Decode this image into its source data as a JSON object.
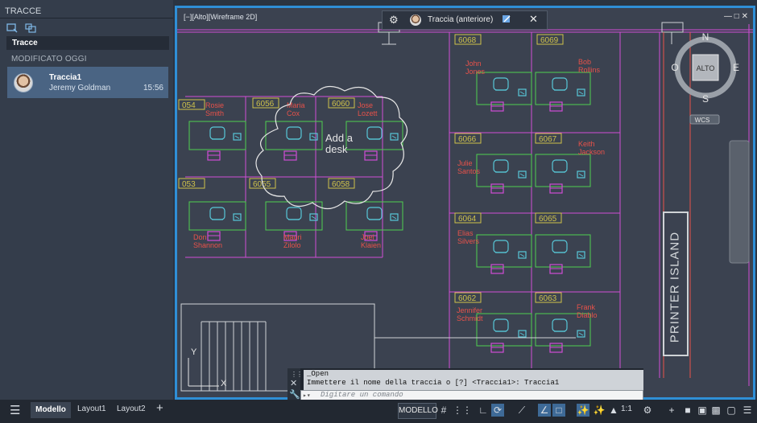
{
  "panel": {
    "title": "TRACCE",
    "tab": "Tracce",
    "section": "MODIFICATO OGGI",
    "item": {
      "name": "Traccia1",
      "author": "Jeremy Goldman",
      "time": "15:56"
    }
  },
  "viewport": {
    "label": "[−][Alto][Wireframe 2D]",
    "controls": "—  □  ✕"
  },
  "trace_bar": {
    "label": "Traccia (anteriore)"
  },
  "viewcube": {
    "top": "ALTO",
    "n": "N",
    "s": "S",
    "e": "E",
    "o": "O",
    "wcs": "WCS"
  },
  "drawing": {
    "rooms": [
      "6068",
      "6069",
      "6056",
      "6060",
      "6066",
      "6067",
      "054",
      "6055",
      "6058",
      "053",
      "6064",
      "6065",
      "6062",
      "6063"
    ],
    "names": [
      "John\nJones",
      "Bob\nRollins",
      "Rosie\nSmith",
      "Maria\nCox",
      "Jose\nLozett",
      "Julie\nSantos",
      "Keith\nJackson",
      "Don\nShannon",
      "Mauri\nZilolo",
      "Joel\nKlaien",
      "Elias\nSilvers",
      "Jennifer\nSchmidt",
      "Frank\nDiablo"
    ],
    "cloud_note": "Add a\ndesk",
    "printer_label": "PRINTER ISLAND",
    "ucs_x": "X",
    "ucs_y": "Y"
  },
  "command": {
    "line1": "_Open",
    "line2": "Immettere il nome della traccia o [?] <Traccia1>: Traccia1",
    "placeholder": "Digitare un comando"
  },
  "status": {
    "tabs": [
      "Modello",
      "Layout1",
      "Layout2"
    ],
    "model_btn": "MODELLO",
    "scale": "1:1"
  },
  "colors": {
    "accent": "#2f8fd6",
    "magenta": "#d04dd6",
    "green": "#4fd04f",
    "cyan": "#58c8d8",
    "yellow": "#cfc24a",
    "red": "#e8524a"
  }
}
